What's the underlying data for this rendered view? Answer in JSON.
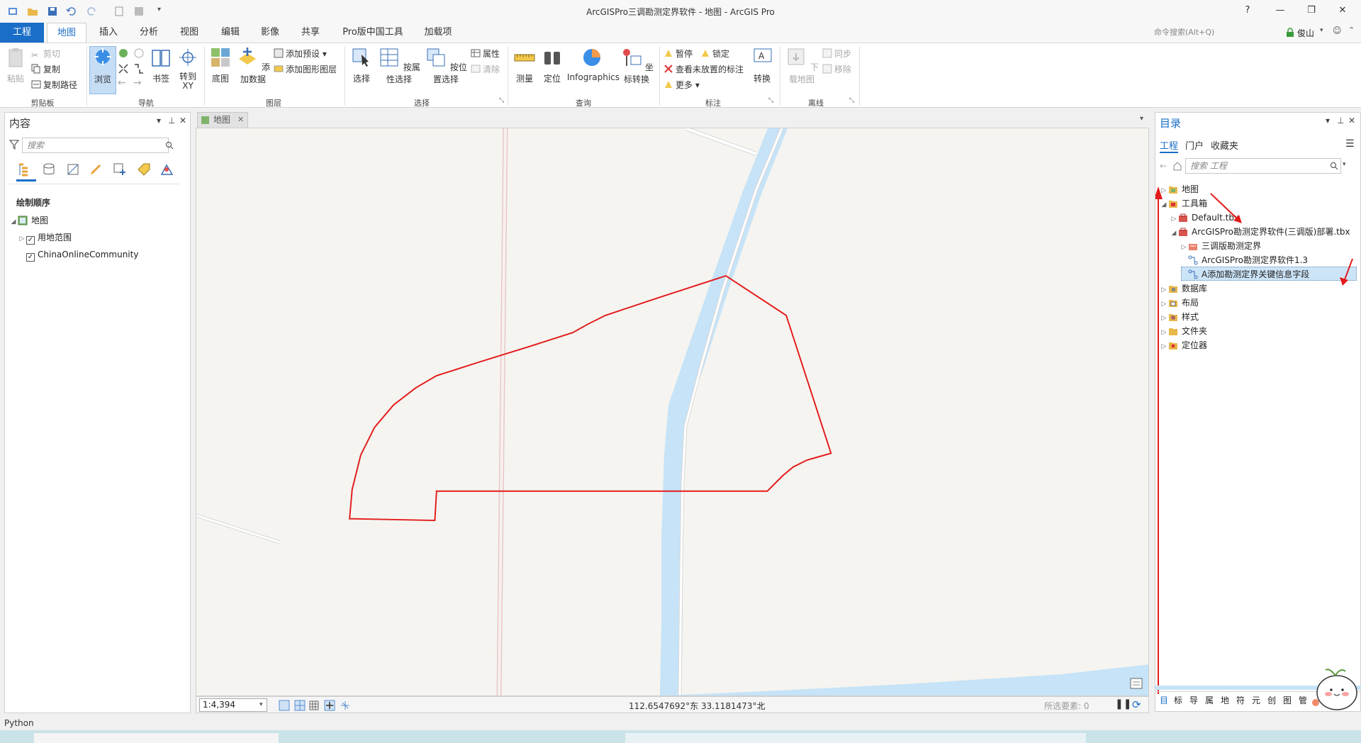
{
  "app": {
    "window_title": "ArcGISPro三调勘测定界软件 - 地图 - ArcGIS Pro",
    "help": "?",
    "user": "俊山",
    "command_search_placeholder": "命令搜索(Alt+Q)"
  },
  "tabs": [
    {
      "label": "工程"
    },
    {
      "label": "地图"
    },
    {
      "label": "插入"
    },
    {
      "label": "分析"
    },
    {
      "label": "视图"
    },
    {
      "label": "编辑"
    },
    {
      "label": "影像"
    },
    {
      "label": "共享"
    },
    {
      "label": "Pro版中国工具"
    },
    {
      "label": "加载项"
    }
  ],
  "ribbon": {
    "clipboard": {
      "paste": "粘贴",
      "cut": "剪切",
      "copy": "复制",
      "copy_path": "复制路径",
      "label": "剪贴板"
    },
    "navigate": {
      "explore": "浏览",
      "bookmarks": "书签",
      "goto_xy": "转到\nXY",
      "label": "导航"
    },
    "layer": {
      "basemap": "底图",
      "add_data": "添加数据",
      "add_preset": "添加预设",
      "add_graphics": "添加图形图层",
      "label": "图层"
    },
    "selection": {
      "select": "选择",
      "by_attr": "按属性选择",
      "by_loc": "按位置选择",
      "attributes": "属性",
      "clear": "清除",
      "label": "选择"
    },
    "inquiry": {
      "measure": "测量",
      "locate": "定位",
      "infographics": "Infographics",
      "convert_coords": "坐标转换",
      "label": "查询"
    },
    "labeling": {
      "pause": "暂停",
      "lock": "锁定",
      "view_unplaced": "查看未放置的标注",
      "more": "更多",
      "convert": "转换",
      "label": "标注"
    },
    "offline": {
      "download_map": "下载地图",
      "sync": "同步",
      "remove": "移除",
      "label": "离线"
    }
  },
  "contents": {
    "title": "内容",
    "search_placeholder": "搜索",
    "drawing_order": "绘制顺序",
    "items": [
      {
        "label": "地图",
        "level": 0,
        "checkbox": false,
        "checked": false
      },
      {
        "label": "用地范围",
        "level": 1,
        "checkbox": true,
        "checked": true
      },
      {
        "label": "ChinaOnlineCommunity",
        "level": 1,
        "checkbox": true,
        "checked": true
      }
    ]
  },
  "map": {
    "tab_label": "地图",
    "scale": "1:4,394",
    "coordinates": "112.6547692°东 33.1181473°北",
    "selected_features": "所选要素: 0",
    "colors": {
      "parcel_outline": "#e31b1b",
      "water": "#c6e3f7",
      "background": "#f5f4f0",
      "road": "#e6e6e6"
    }
  },
  "catalog": {
    "title": "目录",
    "tabs": [
      "工程",
      "门户",
      "收藏夹"
    ],
    "search_placeholder": "搜索 工程",
    "items": [
      {
        "label": "地图",
        "level": 0,
        "expanded": false
      },
      {
        "label": "工具箱",
        "level": 0,
        "expanded": true
      },
      {
        "label": "Default.tbx",
        "level": 1,
        "expanded": false
      },
      {
        "label": "ArcGISPro勘测定界软件(三调版)部署.tbx",
        "level": 1,
        "expanded": true
      },
      {
        "label": "三调版勘测定界",
        "level": 2,
        "expanded": false
      },
      {
        "label": "ArcGISPro勘测定界软件1.3",
        "level": 2,
        "expanded": null
      },
      {
        "label": "A添加勘测定界关键信息字段",
        "level": 2,
        "expanded": null,
        "selected": true
      },
      {
        "label": "数据库",
        "level": 0,
        "expanded": false
      },
      {
        "label": "布局",
        "level": 0,
        "expanded": false
      },
      {
        "label": "样式",
        "level": 0,
        "expanded": false
      },
      {
        "label": "文件夹",
        "level": 0,
        "expanded": false
      },
      {
        "label": "定位器",
        "level": 0,
        "expanded": false
      }
    ],
    "bottom_tabs": [
      "目",
      "标",
      "导",
      "属",
      "地",
      "符",
      "元",
      "创",
      "图",
      "管"
    ]
  },
  "python_label": "Python"
}
